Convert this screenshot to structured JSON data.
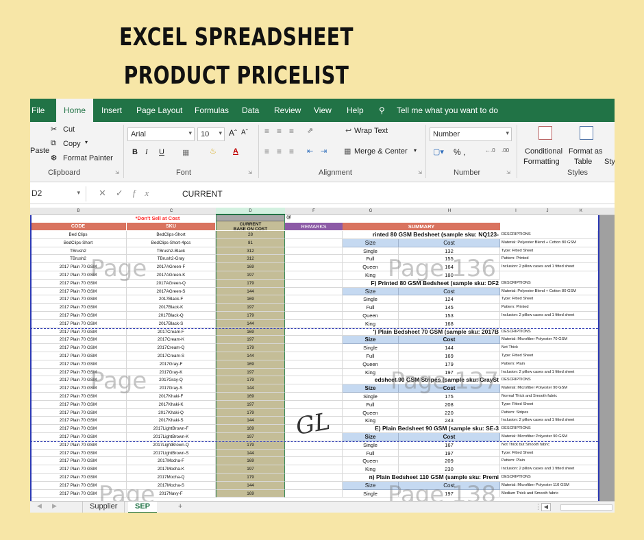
{
  "promo": {
    "line1": "EXCEL SPREADSHEET",
    "line2": "PRODUCT PRICELIST"
  },
  "menu": [
    "File",
    "Home",
    "Insert",
    "Page Layout",
    "Formulas",
    "Data",
    "Review",
    "View",
    "Help",
    "Tell me what you want to do"
  ],
  "ribbon": {
    "clipboard": {
      "cut": "Cut",
      "copy": "Copy",
      "paste": "Paste",
      "format_painter": "Format Painter",
      "label": "Clipboard"
    },
    "font": {
      "name": "Arial",
      "size": "10",
      "label": "Font",
      "bold": "B",
      "italic": "I",
      "underline": "U"
    },
    "alignment": {
      "wrap": "Wrap Text",
      "merge": "Merge & Center",
      "label": "Alignment"
    },
    "number": {
      "format": "Number",
      "label": "Number",
      "symbols": "% ,"
    },
    "styles": {
      "conditional": "Conditional",
      "formatting": "Formatting",
      "format_as": "Format as",
      "table": "Table",
      "cell_sty": "Sty",
      "label": "Styles"
    }
  },
  "formula_bar": {
    "name_box": "D2",
    "content": "CURRENT"
  },
  "columns": [
    "B",
    "C",
    "D",
    "F",
    "G",
    "H",
    "I",
    "J",
    "K"
  ],
  "header": {
    "dont_sell": "*Don't Sell at Cost",
    "code": "CODE",
    "sku": "SKU",
    "current": "CURRENT",
    "base_on_cost": "BASE ON COST",
    "remarks": "REMARKS",
    "summary": "SUMMARY"
  },
  "rows": [
    {
      "code": "Bed Clips",
      "sku": "BedClips-Short",
      "cost": "28"
    },
    {
      "code": "BedClips-Short",
      "sku": "BedClips-Short-4pcs",
      "cost": "81"
    },
    {
      "code": "TBrush2",
      "sku": "TBrush2-Black",
      "cost": "312"
    },
    {
      "code": "TBrush2",
      "sku": "TBrush2-Gray",
      "cost": "312"
    },
    {
      "code": "2017 Plain 70 GSM",
      "sku": "2017AGreen-F",
      "cost": "169"
    },
    {
      "code": "2017 Plain 70 GSM",
      "sku": "2017AGreen-K",
      "cost": "197"
    },
    {
      "code": "2017 Plain 70 GSM",
      "sku": "2017AGreen-Q",
      "cost": "179"
    },
    {
      "code": "2017 Plain 70 GSM",
      "sku": "2017AGreen-S",
      "cost": "144"
    },
    {
      "code": "2017 Plain 70 GSM",
      "sku": "2017Black-F",
      "cost": "169"
    },
    {
      "code": "2017 Plain 70 GSM",
      "sku": "2017Black-K",
      "cost": "197"
    },
    {
      "code": "2017 Plain 70 GSM",
      "sku": "2017Black-Q",
      "cost": "179"
    },
    {
      "code": "2017 Plain 70 GSM",
      "sku": "2017Black-S",
      "cost": "144"
    },
    {
      "code": "2017 Plain 70 GSM",
      "sku": "2017Cream-F",
      "cost": "169"
    },
    {
      "code": "2017 Plain 70 GSM",
      "sku": "2017Cream-K",
      "cost": "197"
    },
    {
      "code": "2017 Plain 70 GSM",
      "sku": "2017Cream-Q",
      "cost": "179"
    },
    {
      "code": "2017 Plain 70 GSM",
      "sku": "2017Cream-S",
      "cost": "144"
    },
    {
      "code": "2017 Plain 70 GSM",
      "sku": "2017Gray-F",
      "cost": "169"
    },
    {
      "code": "2017 Plain 70 GSM",
      "sku": "2017Gray-K",
      "cost": "197"
    },
    {
      "code": "2017 Plain 70 GSM",
      "sku": "2017Gray-Q",
      "cost": "179"
    },
    {
      "code": "2017 Plain 70 GSM",
      "sku": "2017Gray-S",
      "cost": "144"
    },
    {
      "code": "2017 Plain 70 GSM",
      "sku": "2017Khaki-F",
      "cost": "169"
    },
    {
      "code": "2017 Plain 70 GSM",
      "sku": "2017Khaki-K",
      "cost": "197"
    },
    {
      "code": "2017 Plain 70 GSM",
      "sku": "2017Khaki-Q",
      "cost": "179"
    },
    {
      "code": "2017 Plain 70 GSM",
      "sku": "2017Khaki-S",
      "cost": "144"
    },
    {
      "code": "2017 Plain 70 GSM",
      "sku": "2017LightBrown-F",
      "cost": "169"
    },
    {
      "code": "2017 Plain 70 GSM",
      "sku": "2017LightBrown-K",
      "cost": "197"
    },
    {
      "code": "2017 Plain 70 GSM",
      "sku": "2017LightBrown-Q",
      "cost": "179"
    },
    {
      "code": "2017 Plain 70 GSM",
      "sku": "2017LightBrown-S",
      "cost": "144"
    },
    {
      "code": "2017 Plain 70 GSM",
      "sku": "2017Mocha-F",
      "cost": "169"
    },
    {
      "code": "2017 Plain 70 GSM",
      "sku": "2017Mocha-K",
      "cost": "197"
    },
    {
      "code": "2017 Plain 70 GSM",
      "sku": "2017Mocha-Q",
      "cost": "179"
    },
    {
      "code": "2017 Plain 70 GSM",
      "sku": "2017Mocha-S",
      "cost": "144"
    },
    {
      "code": "2017 Plain 70 GSM",
      "sku": "2017Navy-F",
      "cost": "169"
    }
  ],
  "summary_blocks": [
    {
      "title": "rinted 80 GSM Bedsheet (sample sku: NQ123-",
      "head_bold": false,
      "items": [
        [
          "Single",
          "132"
        ],
        [
          "Full",
          "155"
        ],
        [
          "Queen",
          "164"
        ],
        [
          "King",
          "180"
        ]
      ],
      "desc": [
        "DESCRIPTIONS",
        "Material: Polyester Blend + Cotton 80 GSM",
        "Type: Fitted Sheet",
        "Pattern: Printed",
        "Inclusion: 2 pillow cases and 1 fitted sheet"
      ]
    },
    {
      "title": "F) Printed 80 GSM Bedsheet (sample sku: DF2",
      "head_bold": false,
      "items": [
        [
          "Single",
          "124"
        ],
        [
          "Full",
          "145"
        ],
        [
          "Queen",
          "153"
        ],
        [
          "King",
          "168"
        ]
      ],
      "desc": [
        "DESCRIPTIONS",
        "Material: Polyester Blend + Cotton 80 GSM",
        "Type: Fitted Sheet",
        "Pattern: Printed",
        "Inclusion: 2 pillow cases and 1 fitted sheet"
      ]
    },
    {
      "title": "') Plain Bedsheet  70 GSM (sample sku: 2017B",
      "head_bold": true,
      "items": [
        [
          "Single",
          "144"
        ],
        [
          "Full",
          "169"
        ],
        [
          "Queen",
          "179"
        ],
        [
          "King",
          "197"
        ]
      ],
      "desc": [
        "DESCRIPTIONS",
        "Material: Microfiber Polyester 70 GSM",
        "Not Thick",
        "Type: Fitted Sheet",
        "Pattern: Plain",
        "Inclusion: 2 pillow cases and 1 fitted sheet"
      ]
    },
    {
      "title": "edsheet 90 GSM Stripes (sample sku: GraySt",
      "head_bold": true,
      "items": [
        [
          "Single",
          "175"
        ],
        [
          "Full",
          "208"
        ],
        [
          "Queen",
          "220"
        ],
        [
          "King",
          "243"
        ]
      ],
      "desc": [
        "DESCRIPTIONS",
        "Material: Microfiber Polyester 90 GSM",
        "Normal Thick and Smooth fabric",
        "Type: Fitted Sheet",
        "Pattern: Stripes",
        "Inclusion: 2 pillow cases and 1 fitted sheet"
      ]
    },
    {
      "title": "E) Plain Bedsheet 90 GSM (sample sku: SE-3",
      "head_bold": true,
      "items": [
        [
          "Single",
          "167"
        ],
        [
          "Full",
          "197"
        ],
        [
          "Queen",
          "209"
        ],
        [
          "King",
          "230"
        ]
      ],
      "desc": [
        "DESCRIPTIONS",
        "Material: Microfiber Polyester 90 GSM",
        "Not Thick but Smooth fabric",
        "Type: Fitted Sheet",
        "Pattern: Plain",
        "Inclusion: 2 pillow cases and 1 fitted sheet"
      ]
    },
    {
      "title": "n) Plain Bedsheet 110 GSM (sample sku: Premi",
      "head_bold": false,
      "items": [
        [
          "Single",
          "197"
        ]
      ],
      "desc": [
        "DESCRIPTIONS",
        "Material: Microfiber Polyester 110 GSM",
        "Medium Thick and Smooth fabric"
      ]
    }
  ],
  "summary_heads": {
    "size": "Size",
    "cost": "Cost"
  },
  "watermarks": {
    "p136": "Page 136",
    "p137": "Page 137",
    "p138": "Page 138",
    "page": "Page"
  },
  "remarks_marker": "@",
  "signature": "GL",
  "tabs": {
    "supplier": "Supplier",
    "sep": "SEP",
    "add": "+"
  },
  "colors": {
    "excel_green": "#217346",
    "header_salmon": "#d9735f",
    "remarks_purple": "#8c5aa6",
    "cost_tan": "#c4bd97",
    "summary_blue": "#c5d9f1",
    "page_bg": "#f7e6a7"
  }
}
